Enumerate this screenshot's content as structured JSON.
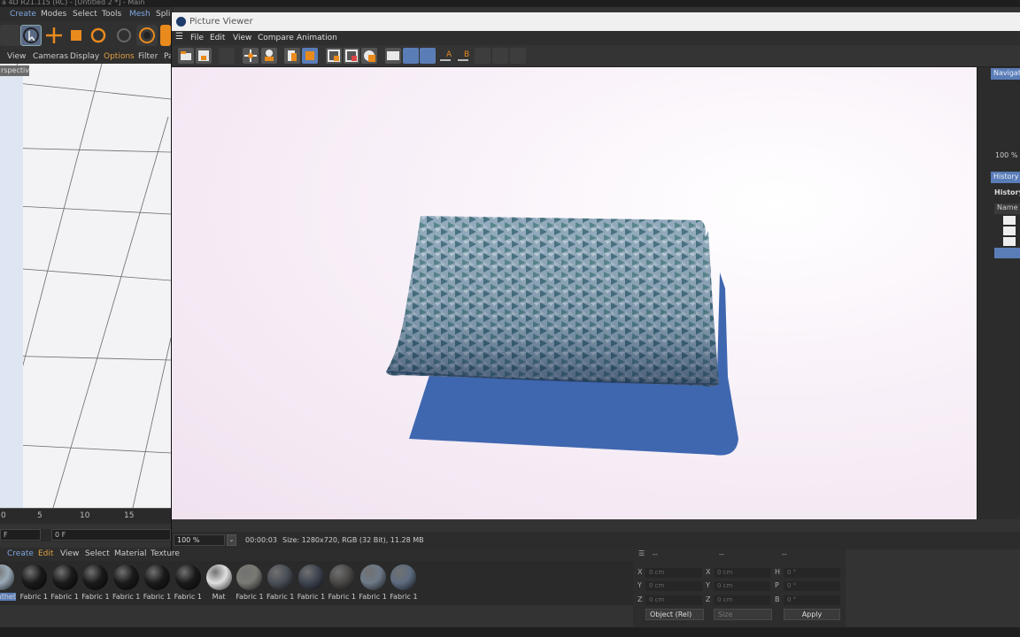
{
  "main_window": {
    "title": "a 4D R21.115 (RC) - [Untitled 2 *] - Main",
    "menu": [
      "Create",
      "Modes",
      "Select",
      "Tools",
      "Mesh",
      "Spli"
    ],
    "viewport_menu": [
      "View",
      "Cameras",
      "Display",
      "Options",
      "Filter",
      "Pa"
    ],
    "viewport_label": "rspective",
    "timeline_ticks": [
      "0",
      "5",
      "10",
      "15"
    ],
    "frame_start": "F",
    "frame_current": "0 F"
  },
  "picture_viewer": {
    "title": "Picture Viewer",
    "menu": [
      "File",
      "Edit",
      "View",
      "Compare",
      "Animation"
    ],
    "zoom": "100 %",
    "time": "00:00:03",
    "size_info": "Size: 1280x720, RGB (32 Bit), 11.28 MB",
    "sidebar": {
      "navigator_tab": "Navigato",
      "zoom_value": "100 %",
      "history_tab": "History",
      "history_heading": "History",
      "name_column": "Name"
    }
  },
  "material_manager": {
    "menu": [
      "Create",
      "Edit",
      "View",
      "Select",
      "Material",
      "Texture"
    ],
    "materials": [
      {
        "label": "nthet",
        "color": "#9aaab8"
      },
      {
        "label": "Fabric 1",
        "color": "#1a1a1a"
      },
      {
        "label": "Fabric 1",
        "color": "#1a1a1a"
      },
      {
        "label": "Fabric 1",
        "color": "#1a1a1a"
      },
      {
        "label": "Fabric 1",
        "color": "#1a1a1a"
      },
      {
        "label": "Fabric 1",
        "color": "#1a1a1a"
      },
      {
        "label": "Fabric 1",
        "color": "#1a1a1a"
      },
      {
        "label": "Mat",
        "color": "#e0e0e0"
      },
      {
        "label": "Fabric 1",
        "color": "#7a7a74"
      },
      {
        "label": "Fabric 1",
        "color": "#4a4e56"
      },
      {
        "label": "Fabric 1",
        "color": "#3e4450"
      },
      {
        "label": "Fabric 1",
        "color": "#4a4646"
      },
      {
        "label": "Fabric 1",
        "color": "#6e7a88"
      },
      {
        "label": "Fabric 1",
        "color": "#5d6c80"
      }
    ]
  },
  "coordinates": {
    "header": [
      "--",
      "--",
      "--"
    ],
    "rows": [
      {
        "a": "X",
        "av": "0 cm",
        "b": "X",
        "bv": "0 cm",
        "c": "H",
        "cv": "0 °"
      },
      {
        "a": "Y",
        "av": "0 cm",
        "b": "Y",
        "bv": "0 cm",
        "c": "P",
        "cv": "0 °"
      },
      {
        "a": "Z",
        "av": "0 cm",
        "b": "Z",
        "bv": "0 cm",
        "c": "B",
        "cv": "0 °"
      }
    ],
    "mode": "Object (Rel)",
    "size_mode": "Size",
    "apply": "Apply"
  },
  "colors": {
    "accent": "#5a7db8",
    "pillow": "#6d8aa3",
    "shadow": "#3f67b0",
    "background": "#f3e6f2"
  }
}
